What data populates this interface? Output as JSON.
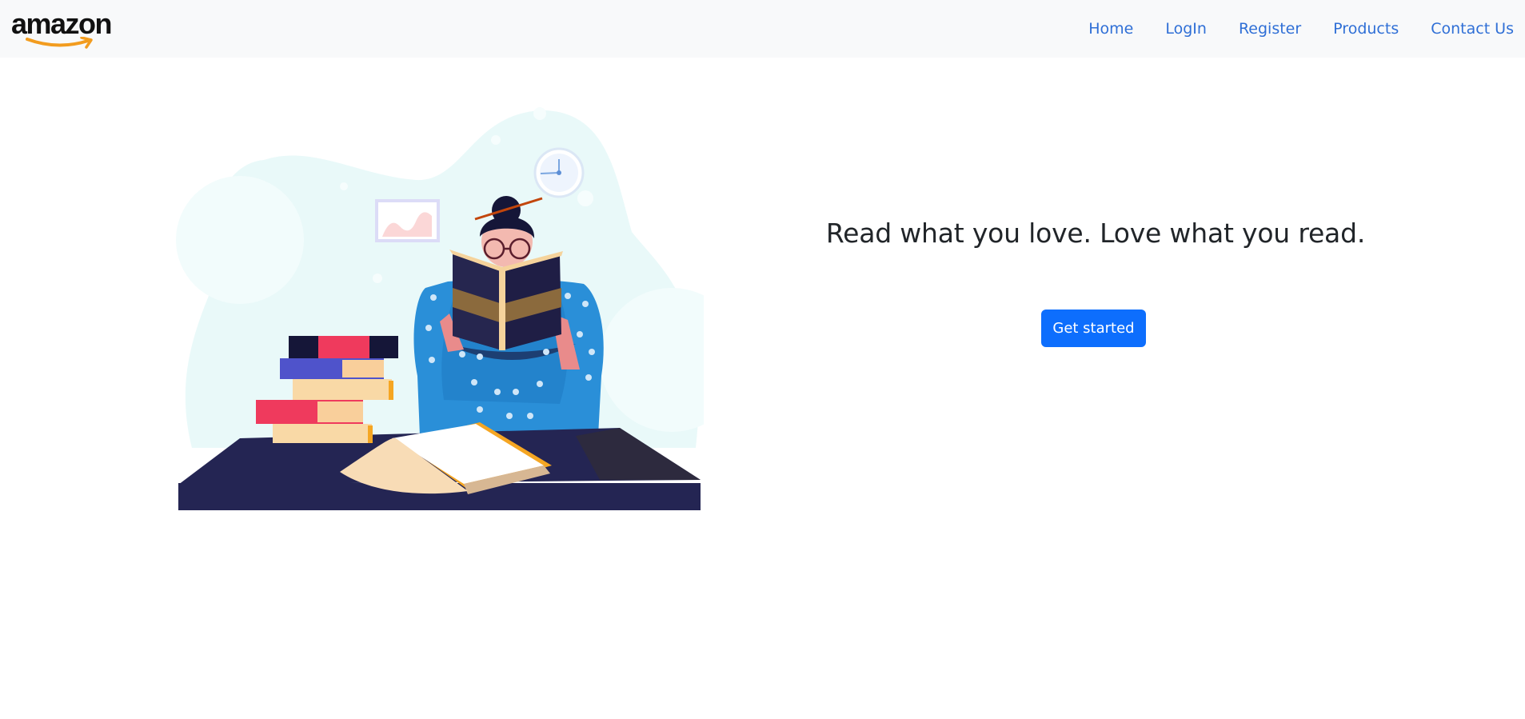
{
  "brand": {
    "logo_text": "amazon",
    "smile_color": "#f29c1f"
  },
  "nav": {
    "items": [
      {
        "label": "Home"
      },
      {
        "label": "LogIn"
      },
      {
        "label": "Register"
      },
      {
        "label": "Products"
      },
      {
        "label": "Contact Us"
      }
    ],
    "link_color": "#2f6fd6"
  },
  "hero": {
    "headline": "Read what you love. Love what you read.",
    "cta_label": "Get started",
    "illustration_icon": "woman-reading-book-illustration"
  },
  "colors": {
    "primary": "#0d6efd",
    "navbar_bg": "#f8f9fa",
    "desk": "#242553",
    "sweater": "#2a8fd8"
  }
}
